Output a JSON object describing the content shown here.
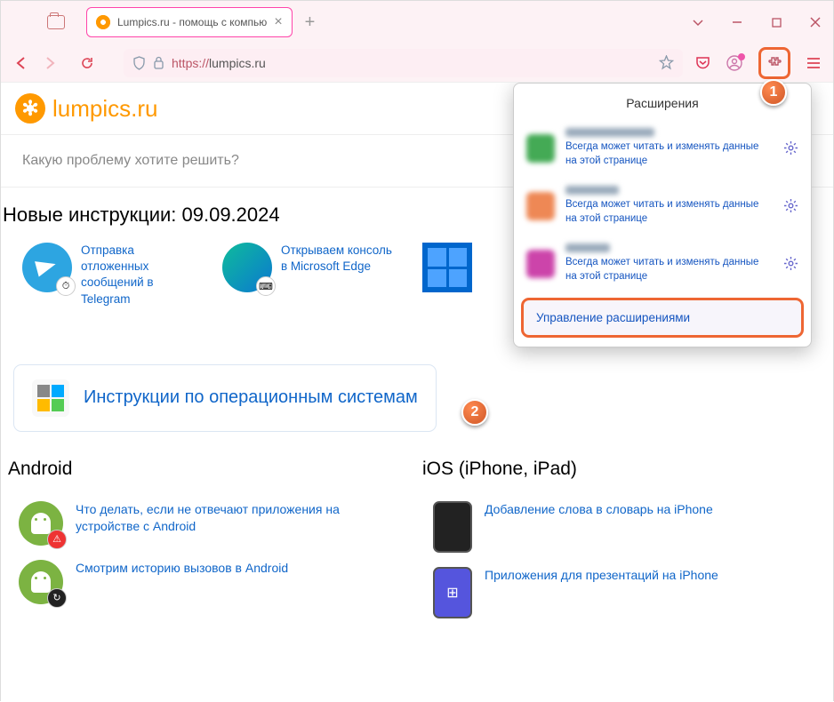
{
  "tab": {
    "title": "Lumpics.ru - помощь с компью"
  },
  "url": {
    "protocol": "https://",
    "host": "lumpics.ru"
  },
  "site": {
    "name": "lumpics.ru"
  },
  "search": {
    "placeholder": "Какую проблему хотите решить?"
  },
  "section": {
    "title": "Новые инструкции: 09.09.2024"
  },
  "cards": [
    {
      "title": "Отправка отложенных сообщений в Telegram"
    },
    {
      "title": "Открываем консоль в Microsoft Edge"
    },
    {
      "title": ""
    }
  ],
  "panel": {
    "title": "Инструкции по операционным системам"
  },
  "cols": {
    "android": {
      "title": "Android",
      "items": [
        "Что делать, если не отвечают приложения на устройстве с Android",
        "Смотрим историю вызовов в Android"
      ]
    },
    "ios": {
      "title": "iOS (iPhone, iPad)",
      "items": [
        "Добавление слова в словарь на iPhone",
        "Приложения для презентаций на iPhone"
      ]
    }
  },
  "popup": {
    "title": "Расширения",
    "desc": "Всегда может читать и изменять данные на этой странице",
    "manage": "Управление расширениями"
  },
  "badges": {
    "b1": "1",
    "b2": "2"
  }
}
